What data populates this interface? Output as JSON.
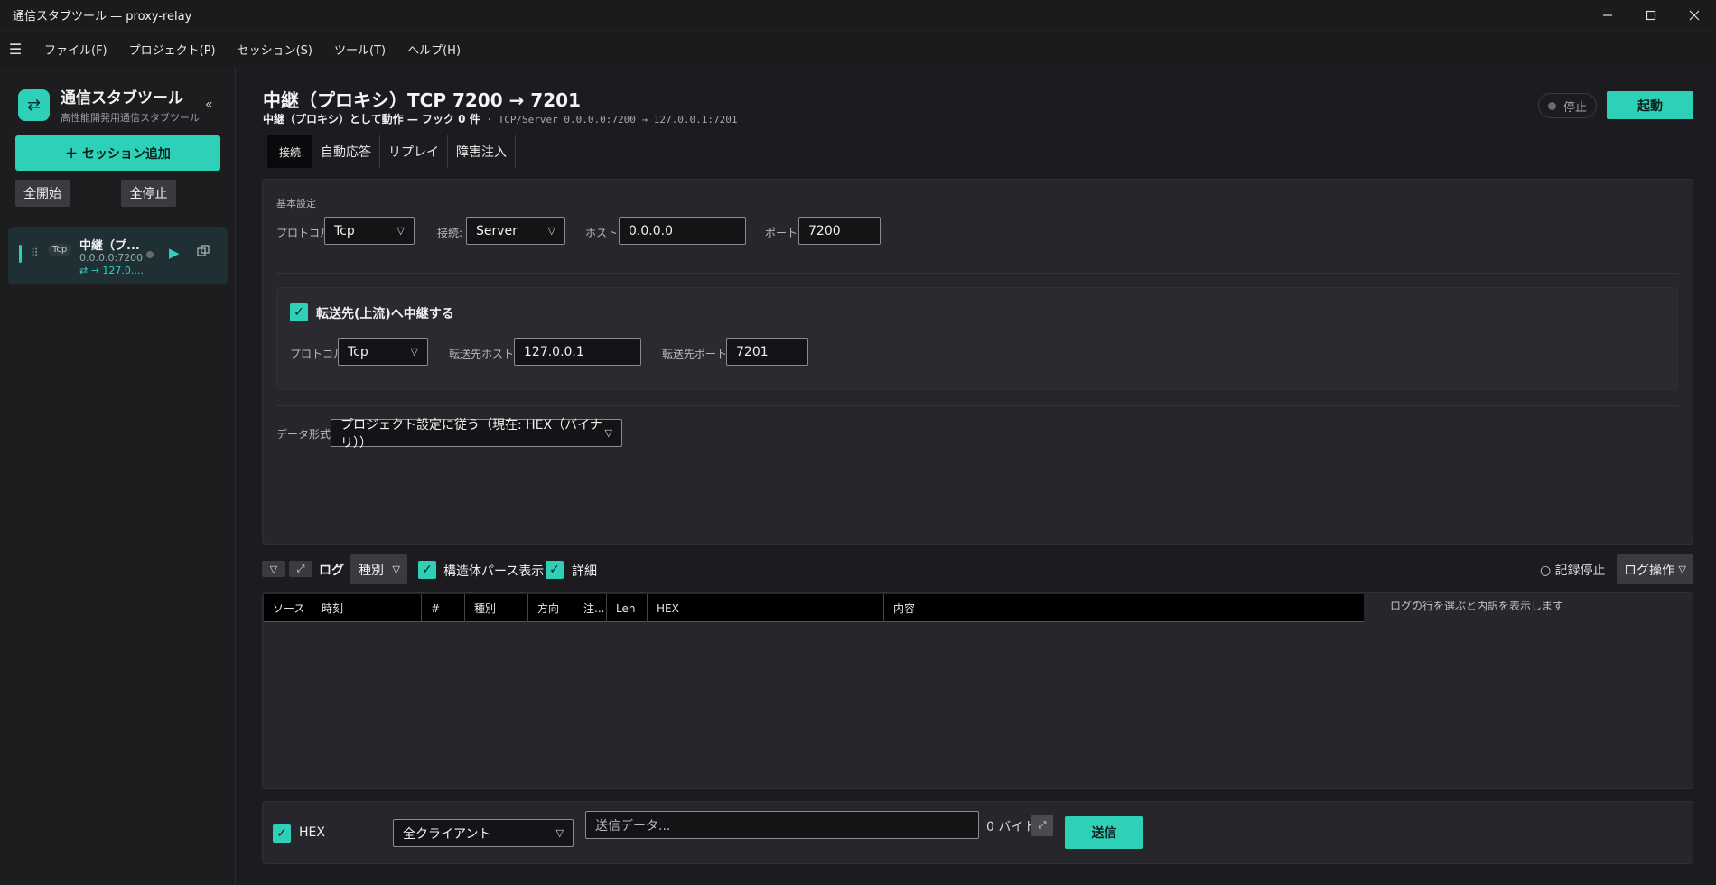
{
  "window": {
    "title": "通信スタブツール — proxy-relay"
  },
  "menu": {
    "items": [
      "ファイル(F)",
      "プロジェクト(P)",
      "セッション(S)",
      "ツール(T)",
      "ヘルプ(H)"
    ]
  },
  "sidebar": {
    "app_name": "通信スタブツール",
    "app_sub": "高性能開発用通信スタブツール",
    "add_session": "＋ セッション追加",
    "start_all": "全開始",
    "stop_all": "全停止",
    "session": {
      "badge": "Tcp",
      "name": "中継（プ...",
      "address": "0.0.0.0:7200",
      "forward": "⇄ → 127.0...."
    }
  },
  "header": {
    "title": "中継（プロキシ）TCP 7200 → 7201",
    "subtitle_main": "中継（プロキシ）として動作 — フック 0 件",
    "subtitle_detail": " · TCP/Server 0.0.0.0:7200 → 127.0.0.1:7201",
    "status": "停止",
    "start": "起動"
  },
  "tabs": [
    "接続",
    "自動応答",
    "リプレイ",
    "障害注入"
  ],
  "basic": {
    "section": "基本設定",
    "protocol_label": "プロトコル:",
    "protocol_value": "Tcp",
    "conn_label": "接続:",
    "conn_value": "Server",
    "host_label": "ホスト:",
    "host_value": "0.0.0.0",
    "port_label": "ポート:",
    "port_value": "7200"
  },
  "relay": {
    "checkbox_label": "転送先(上流)へ中継する",
    "protocol_label": "プロトコル:",
    "protocol_value": "Tcp",
    "host_label": "転送先ホスト:",
    "host_value": "127.0.0.1",
    "port_label": "転送先ポート:",
    "port_value": "7201"
  },
  "data_format": {
    "label": "データ形式:",
    "value": "プロジェクト設定に従う（現在: HEX（バイナリ））"
  },
  "log": {
    "title": "ログ",
    "kind": "種別",
    "struct_parse": "構造体パース表示",
    "detail": "詳細",
    "rec_stop": "○ 記録停止",
    "ops": "ログ操作",
    "columns": [
      "ソース",
      "時刻",
      "#",
      "種別",
      "方向",
      "注...",
      "Len",
      "HEX",
      "内容"
    ],
    "detail_hint": "ログの行を選ぶと内訳を表示します"
  },
  "send": {
    "hex_label": "HEX",
    "target": "全クライアント",
    "placeholder": "送信データ...",
    "bytes": "0 バイト",
    "send": "送信"
  },
  "colors": {
    "accent": "#2ed1b8",
    "background": "#1c1c20",
    "panel": "#26262b"
  }
}
